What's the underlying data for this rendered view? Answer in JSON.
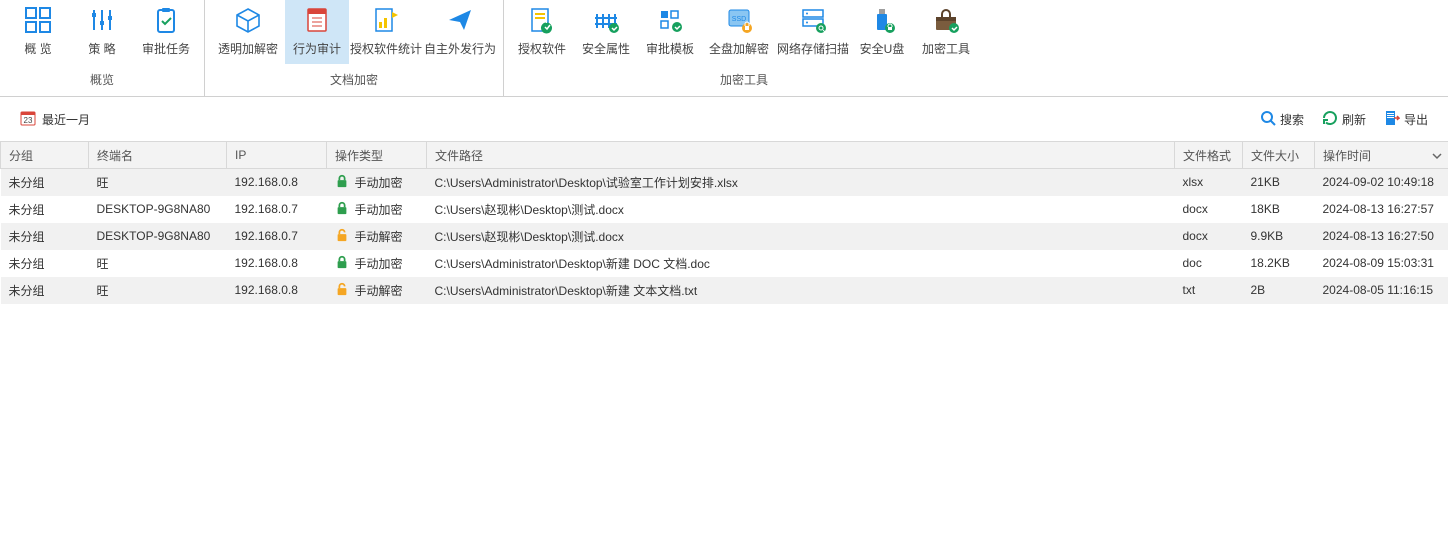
{
  "ribbon": {
    "groups": [
      {
        "title": "概览",
        "items": [
          {
            "id": "overview",
            "label": "概  览",
            "icon": "grid"
          },
          {
            "id": "strategy",
            "label": "策  略",
            "icon": "sliders"
          },
          {
            "id": "approve",
            "label": "审批任务",
            "icon": "clipboard"
          }
        ]
      },
      {
        "title": "文档加密",
        "items": [
          {
            "id": "transparent",
            "label": "透明加解密",
            "icon": "cube"
          },
          {
            "id": "behavior",
            "label": "行为审计",
            "icon": "audit",
            "active": true
          },
          {
            "id": "authstat",
            "label": "授权软件统计",
            "icon": "stats"
          },
          {
            "id": "selfsend",
            "label": "自主外发行为",
            "icon": "send"
          }
        ]
      },
      {
        "title": "加密工具",
        "items": [
          {
            "id": "authsoft",
            "label": "授权软件",
            "icon": "authsoft"
          },
          {
            "id": "secattr",
            "label": "安全属性",
            "icon": "fence"
          },
          {
            "id": "template",
            "label": "审批模板",
            "icon": "template"
          },
          {
            "id": "fulldisk",
            "label": "全盘加解密",
            "icon": "ssd"
          },
          {
            "id": "netscan",
            "label": "网络存储扫描",
            "icon": "server"
          },
          {
            "id": "usb",
            "label": "安全U盘",
            "icon": "usb"
          },
          {
            "id": "tools",
            "label": "加密工具",
            "icon": "toolbox"
          }
        ]
      }
    ]
  },
  "filter": {
    "range": "最近一月"
  },
  "actions": {
    "search": "搜索",
    "refresh": "刷新",
    "export": "导出"
  },
  "columns": {
    "group": "分组",
    "terminal": "终端名",
    "ip": "IP",
    "op": "操作类型",
    "path": "文件路径",
    "fmt": "文件格式",
    "size": "文件大小",
    "time": "操作时间"
  },
  "rows": [
    {
      "group": "未分组",
      "terminal": "旺",
      "ip": "192.168.0.8",
      "opIcon": "lock-green",
      "op": "手动加密",
      "path": "C:\\Users\\Administrator\\Desktop\\试验室工作计划安排.xlsx",
      "fmt": "xlsx",
      "size": "21KB",
      "time": "2024-09-02 10:49:18"
    },
    {
      "group": "未分组",
      "terminal": "DESKTOP-9G8NA80",
      "ip": "192.168.0.7",
      "opIcon": "lock-green",
      "op": "手动加密",
      "path": "C:\\Users\\赵现彬\\Desktop\\测试.docx",
      "fmt": "docx",
      "size": "18KB",
      "time": "2024-08-13 16:27:57"
    },
    {
      "group": "未分组",
      "terminal": "DESKTOP-9G8NA80",
      "ip": "192.168.0.7",
      "opIcon": "lock-orange",
      "op": "手动解密",
      "path": "C:\\Users\\赵现彬\\Desktop\\测试.docx",
      "fmt": "docx",
      "size": "9.9KB",
      "time": "2024-08-13 16:27:50"
    },
    {
      "group": "未分组",
      "terminal": "旺",
      "ip": "192.168.0.8",
      "opIcon": "lock-green",
      "op": "手动加密",
      "path": "C:\\Users\\Administrator\\Desktop\\新建 DOC 文档.doc",
      "fmt": "doc",
      "size": "18.2KB",
      "time": "2024-08-09 15:03:31"
    },
    {
      "group": "未分组",
      "terminal": "旺",
      "ip": "192.168.0.8",
      "opIcon": "lock-orange",
      "op": "手动解密",
      "path": "C:\\Users\\Administrator\\Desktop\\新建 文本文档.txt",
      "fmt": "txt",
      "size": "2B",
      "time": "2024-08-05 11:16:15"
    }
  ]
}
